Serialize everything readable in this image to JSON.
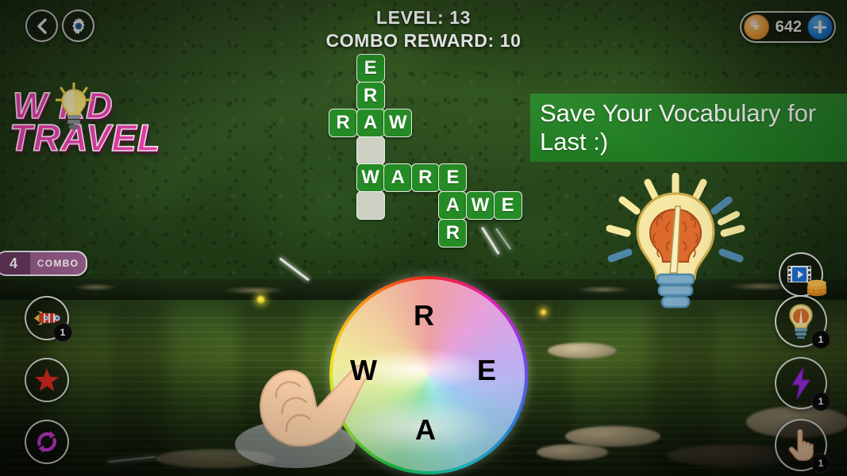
{
  "hud": {
    "level_label": "LEVEL: 13",
    "combo_reward_label": "COMBO REWARD: 10",
    "back_icon": "chevron-left-icon",
    "settings_icon": "gear-icon"
  },
  "currency": {
    "coin_icon": "coin-icon",
    "amount": "642",
    "add_icon": "plus-icon"
  },
  "logo": {
    "line1": "W RD",
    "line2": "TRAVEL",
    "bulb_icon": "lightbulb-icon",
    "color": "#f441b4"
  },
  "banner": {
    "text": "Save Your Vocabulary for Last :)",
    "background": "#24801f"
  },
  "combo": {
    "count": "4",
    "label": "COMBO",
    "color": "#9a5f8d"
  },
  "grid": {
    "tile_color": "#258b25",
    "empty_color": "#e2e4dc",
    "cell": 34,
    "pitch": 34.6,
    "tiles": [
      {
        "row": 0,
        "col": 1,
        "letter": "E",
        "state": "filled"
      },
      {
        "row": 1,
        "col": 1,
        "letter": "R",
        "state": "filled"
      },
      {
        "row": 2,
        "col": 0,
        "letter": "R",
        "state": "filled"
      },
      {
        "row": 2,
        "col": 1,
        "letter": "A",
        "state": "filled"
      },
      {
        "row": 2,
        "col": 2,
        "letter": "W",
        "state": "filled"
      },
      {
        "row": 3,
        "col": 1,
        "letter": "",
        "state": "empty"
      },
      {
        "row": 4,
        "col": 1,
        "letter": "W",
        "state": "filled"
      },
      {
        "row": 4,
        "col": 2,
        "letter": "A",
        "state": "filled"
      },
      {
        "row": 4,
        "col": 3,
        "letter": "R",
        "state": "filled"
      },
      {
        "row": 4,
        "col": 4,
        "letter": "E",
        "state": "filled"
      },
      {
        "row": 5,
        "col": 1,
        "letter": "",
        "state": "empty"
      },
      {
        "row": 5,
        "col": 4,
        "letter": "A",
        "state": "filled"
      },
      {
        "row": 5,
        "col": 5,
        "letter": "W",
        "state": "filled"
      },
      {
        "row": 5,
        "col": 6,
        "letter": "E",
        "state": "filled"
      },
      {
        "row": 6,
        "col": 4,
        "letter": "R",
        "state": "filled"
      }
    ]
  },
  "wheel": {
    "letters": [
      {
        "letter": "R",
        "position": "top"
      },
      {
        "letter": "W",
        "position": "left"
      },
      {
        "letter": "E",
        "position": "right"
      },
      {
        "letter": "A",
        "position": "bottom"
      }
    ]
  },
  "left_buttons": [
    {
      "icon": "rocket-icon",
      "badge": "1"
    },
    {
      "icon": "star-icon",
      "badge": ""
    },
    {
      "icon": "shuffle-icon",
      "badge": ""
    }
  ],
  "right_buttons": [
    {
      "icon": "video-coins-icon",
      "badge": ""
    },
    {
      "icon": "lightbulb-hint-icon",
      "badge": "1"
    },
    {
      "icon": "lightning-icon",
      "badge": "1"
    },
    {
      "icon": "pointing-hand-icon",
      "badge": "1"
    }
  ],
  "decor": {
    "brain_bulb_icon": "brain-lightbulb-icon",
    "hand_cursor_icon": "pointing-hand-cursor-icon"
  }
}
